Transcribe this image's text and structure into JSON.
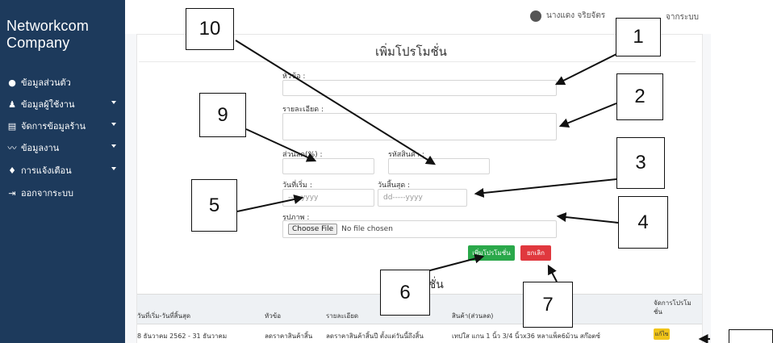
{
  "brand": {
    "line1": "Networkcom",
    "line2": "Company"
  },
  "sidebar": {
    "items": [
      {
        "label": "ข้อมูลส่วนตัว",
        "icon": "user-circle-icon",
        "glyph": "●",
        "has_caret": false
      },
      {
        "label": "ข้อมูลผู้ใช้งาน",
        "icon": "users-icon",
        "glyph": "♟",
        "has_caret": true
      },
      {
        "label": "จัดการข้อมูลร้าน",
        "icon": "document-icon",
        "glyph": "▤",
        "has_caret": true
      },
      {
        "label": "ข้อมูลงาน",
        "icon": "line-chart-icon",
        "glyph": "〰",
        "has_caret": true
      },
      {
        "label": "การแจ้งเตือน",
        "icon": "bell-icon",
        "glyph": "♦",
        "has_caret": true
      },
      {
        "label": "ออกจากระบบ",
        "icon": "sign-out-icon",
        "glyph": "⇥",
        "has_caret": false
      }
    ]
  },
  "topbar": {
    "user_name": "นางแดง จริยจัตร",
    "logout": "จากระบบ"
  },
  "form": {
    "title": "เพิ่มโปรโมชั่น",
    "topic_label": "หัวข้อ :",
    "details_label": "รายละเอียด :",
    "discount_label": "ส่วนลด(%) :",
    "product_code_label": "รหัสสินค้า :",
    "start_date_label": "วันที่เริ่ม :",
    "start_date_placeholder": "-----yyyy",
    "end_date_label": "วันสิ้นสุด :",
    "end_date_placeholder": "dd-----yyyy",
    "image_label": "รูปภาพ :",
    "file_button": "Choose File",
    "file_status": "No file chosen",
    "add_button": "เพิ่มโปรโมชั่น",
    "cancel_button": "ยกเลิก"
  },
  "table": {
    "title": "โมชั่น",
    "headers": [
      "วันที่เริ่ม-วันที่สิ้นสุด",
      "หัวข้อ",
      "รายละเอียด",
      "สินค้า(ส่วนลด)",
      "จัดการโปรโม",
      "ชั่น"
    ],
    "row": {
      "dates": "8 ธันวาคม 2562 - 31 ธันวาคม",
      "topic": "ลดราคาสินค้าสิ้น",
      "details": "ลดราคาสินค้าสิ้นปี ตั้งแต่วันนี้ถึงสิ้น",
      "product": "เทปใส แกน 1 นิ้ว 3/4 นิ้วx36 หลาแพ็ค6ม้วน สก๊อตซ์",
      "edit": "แก้ไข"
    }
  },
  "callouts": {
    "c1": "1",
    "c2": "2",
    "c3": "3",
    "c4": "4",
    "c5": "5",
    "c6": "6",
    "c7": "7",
    "c9": "9",
    "c10": "10"
  },
  "colors": {
    "sidebar_bg": "#1d3a5c",
    "add_button": "#2aa84a",
    "cancel_button": "#e0383e",
    "edit_button": "#f0c419"
  }
}
